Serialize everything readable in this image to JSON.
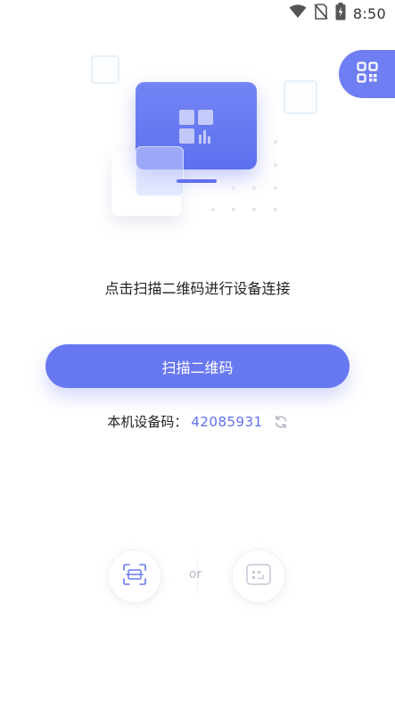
{
  "status_bar": {
    "time": "8:50",
    "icons": [
      "wifi-icon",
      "no-sim-icon",
      "battery-charging-icon"
    ]
  },
  "side_tab": {
    "icon": "qr-code-icon"
  },
  "prompt_text": "点击扫描二维码进行设备连接",
  "scan_button_label": "扫描二维码",
  "device_code": {
    "label": "本机设备码：",
    "value": "42085931",
    "refresh_icon": "refresh-icon"
  },
  "bottom_options": {
    "left_icon": "scan-frame-icon",
    "or_label": "or",
    "right_icon": "code-input-icon"
  },
  "colors": {
    "accent": "#6878f1",
    "accent_dark": "#5e70ee",
    "text": "#222222",
    "muted": "#b8bcc8"
  }
}
